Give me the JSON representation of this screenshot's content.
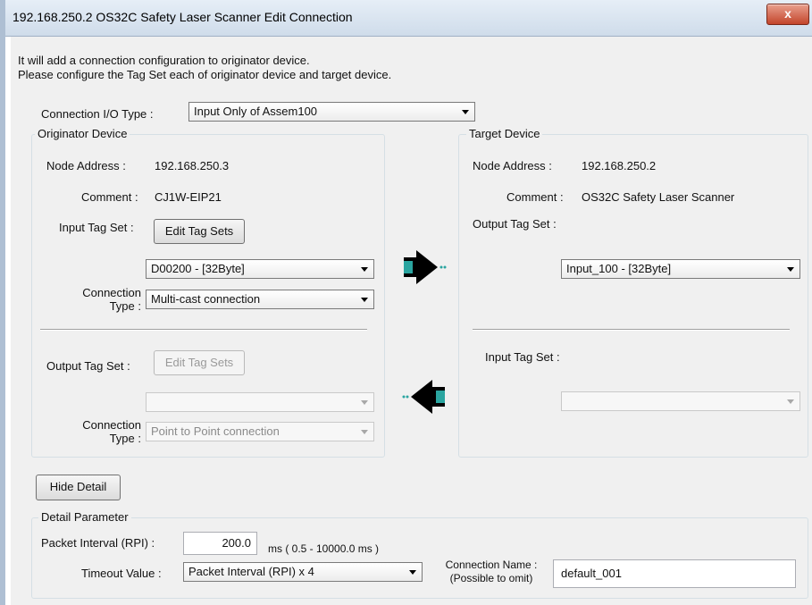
{
  "window": {
    "title": "192.168.250.2 OS32C Safety Laser Scanner Edit Connection",
    "close_label": "x"
  },
  "intro": {
    "line1": "It will add a connection configuration to originator device.",
    "line2": "Please configure the Tag Set each of originator device and target device."
  },
  "connection_io_type": {
    "label": "Connection I/O Type :",
    "value": "Input Only of Assem100"
  },
  "originator": {
    "title": "Originator Device",
    "node_address_label": "Node Address :",
    "node_address": "192.168.250.3",
    "comment_label": "Comment :",
    "comment": "CJ1W-EIP21",
    "input_tag_set_label": "Input Tag Set :",
    "edit_tag_sets_label": "Edit Tag Sets",
    "input_tag_value": "D00200 - [32Byte]",
    "connection_type_label_1": "Connection",
    "connection_type_label_2": "Type :",
    "input_connection_type": "Multi-cast connection",
    "output_tag_set_label": "Output Tag Set :",
    "edit_tag_sets_disabled_label": "Edit Tag Sets",
    "output_tag_value": "",
    "output_connection_type": "Point to Point connection"
  },
  "target": {
    "title": "Target Device",
    "node_address_label": "Node Address :",
    "node_address": "192.168.250.2",
    "comment_label": "Comment :",
    "comment": "OS32C Safety Laser Scanner",
    "output_tag_set_label": "Output Tag Set :",
    "output_tag_value": "Input_100 - [32Byte]",
    "input_tag_set_label": "Input Tag Set :",
    "input_tag_value": ""
  },
  "hide_detail_label": "Hide Detail",
  "detail": {
    "title": "Detail Parameter",
    "rpi_label": "Packet Interval (RPI) :",
    "rpi_value": "200.0",
    "rpi_range": "ms ( 0.5 - 10000.0 ms )",
    "timeout_label": "Timeout Value :",
    "timeout_value": "Packet Interval (RPI) x 4",
    "connection_name_label_1": "Connection Name :",
    "connection_name_label_2": "(Possible to omit)",
    "connection_name_value": "default_001"
  },
  "colors": {
    "arrow_body": "#000000",
    "arrow_accent": "#2aa5a0"
  }
}
